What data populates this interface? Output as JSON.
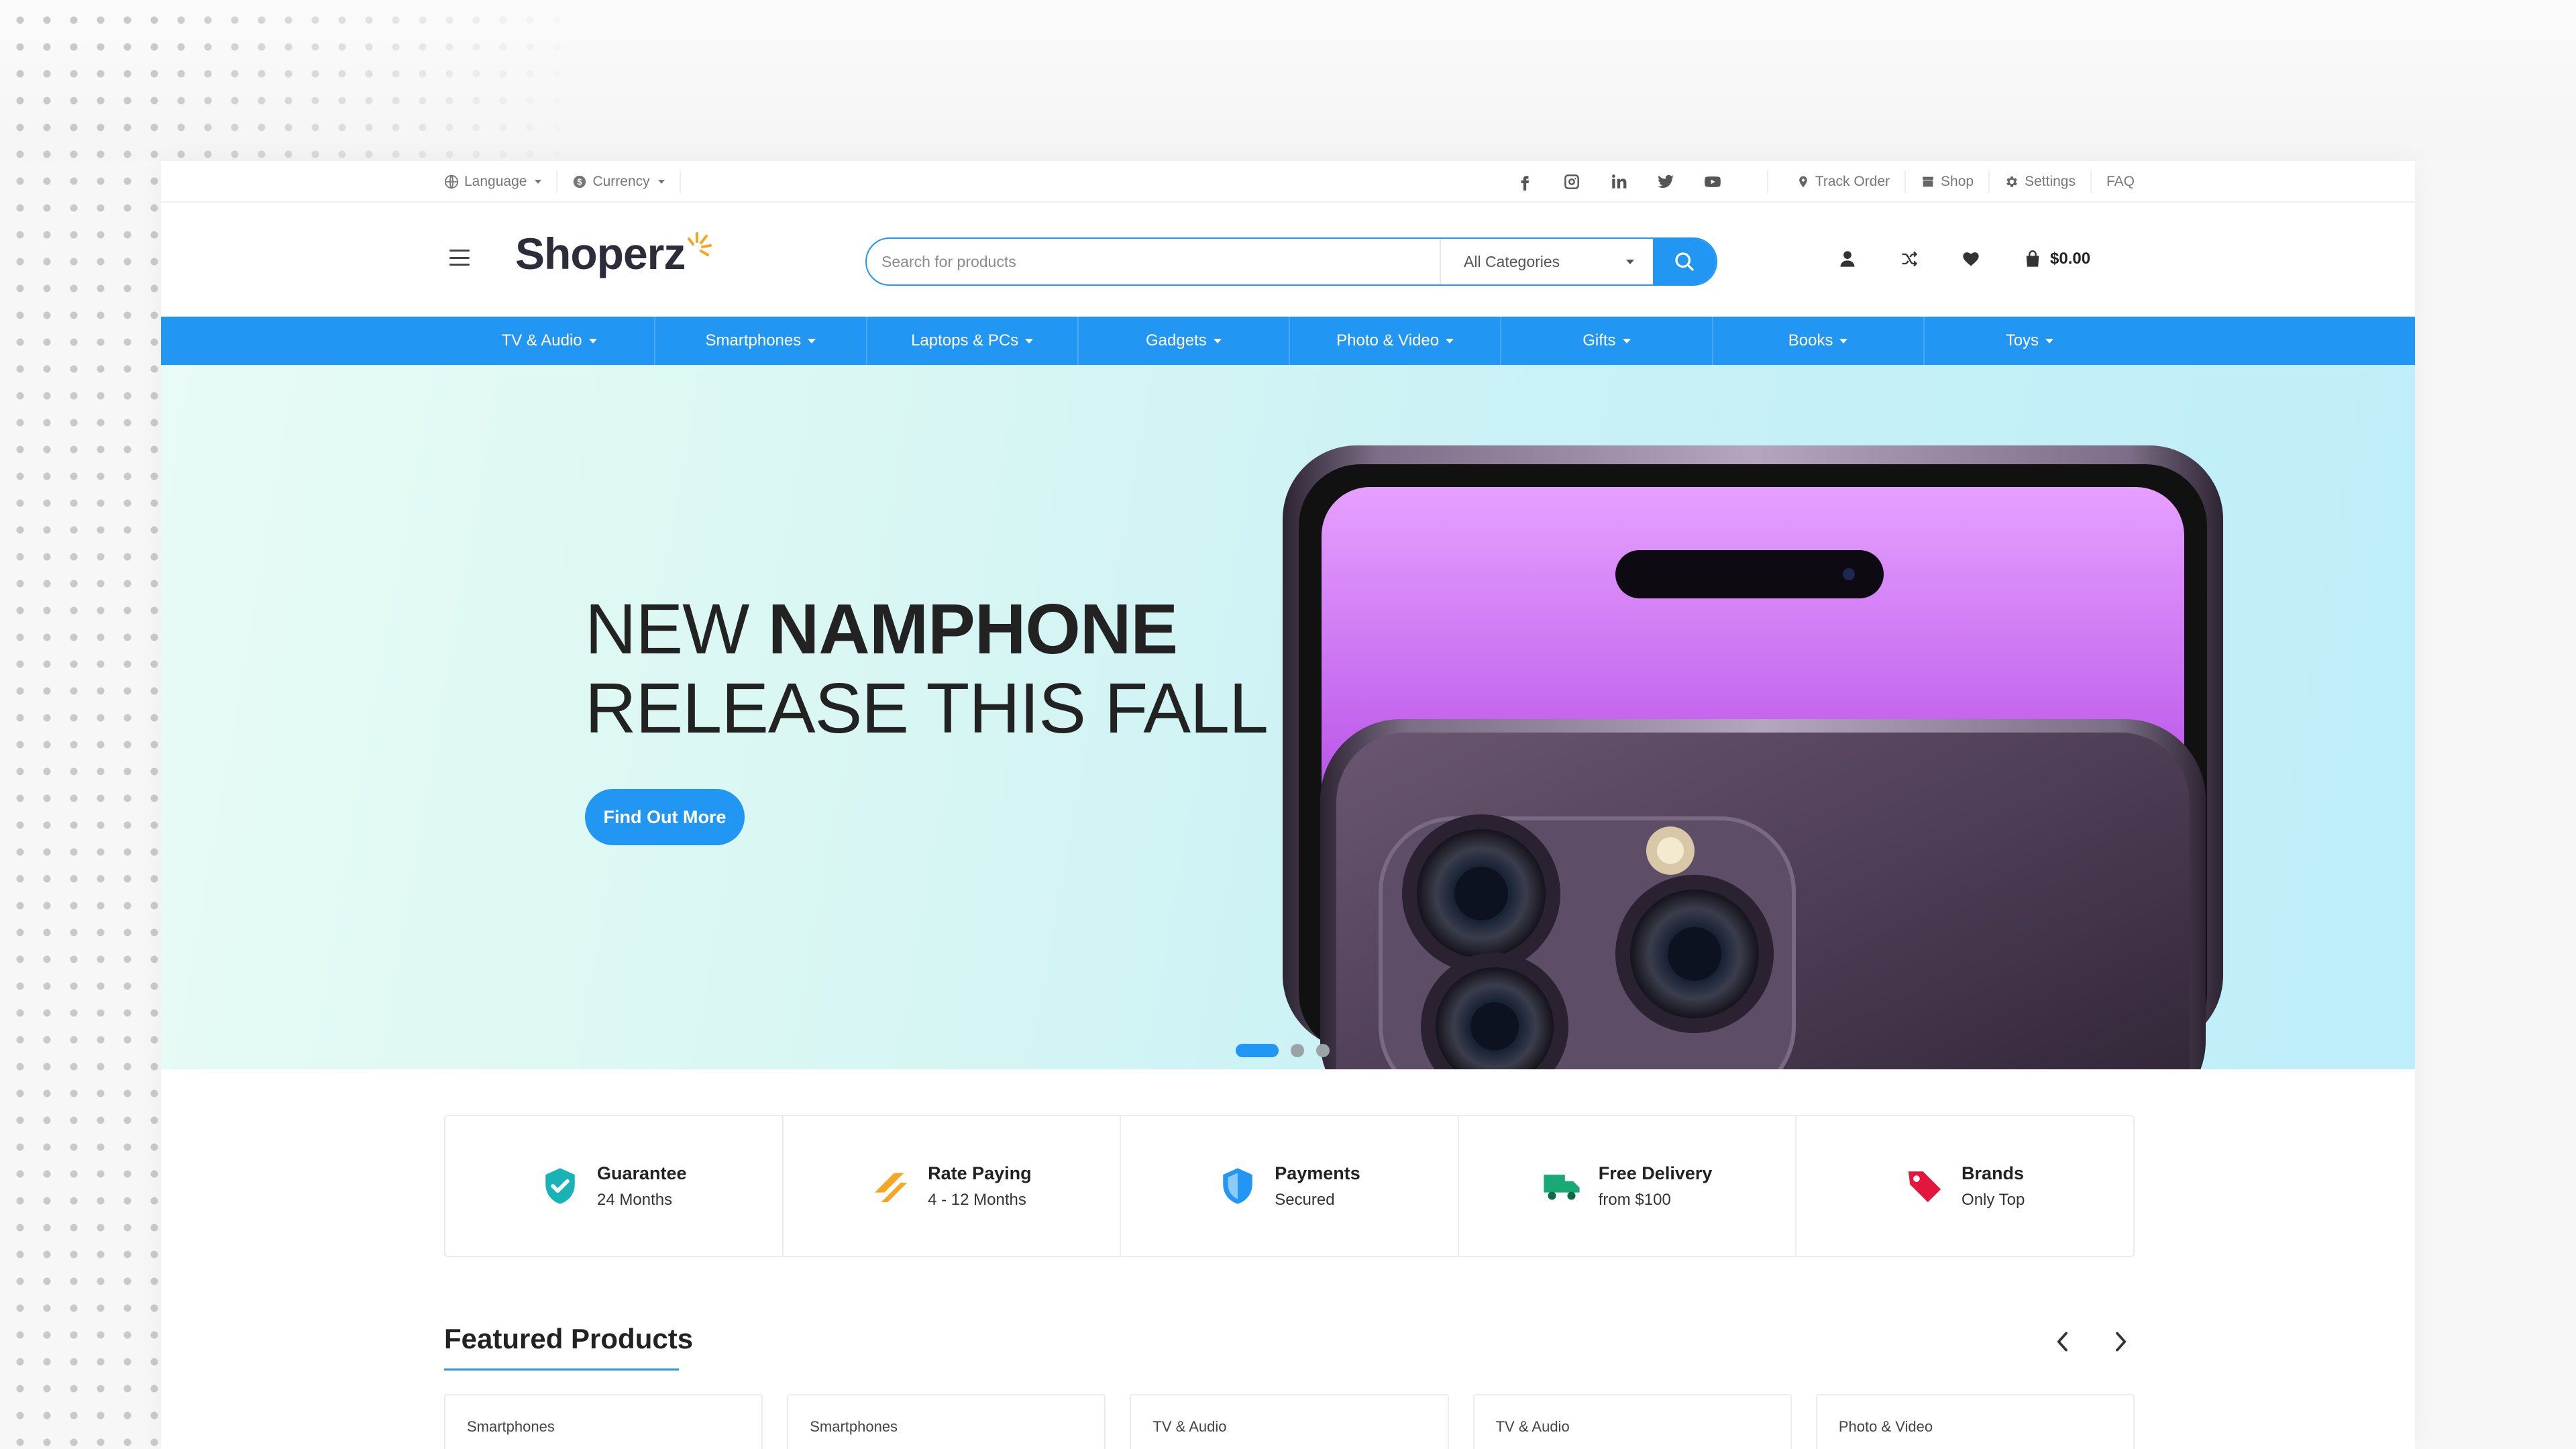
{
  "topbar": {
    "language": "Language",
    "currency": "Currency",
    "social": [
      "facebook-icon",
      "instagram-icon",
      "linkedin-icon",
      "twitter-icon",
      "youtube-icon"
    ],
    "links": {
      "track_order": "Track Order",
      "shop": "Shop",
      "settings": "Settings",
      "faq": "FAQ"
    }
  },
  "header": {
    "logo": "Shoperz",
    "search_placeholder": "Search for products",
    "category": "All Categories",
    "cart_total": "$0.00"
  },
  "nav": [
    {
      "label": "TV & Audio"
    },
    {
      "label": "Smartphones"
    },
    {
      "label": "Laptops & PCs"
    },
    {
      "label": "Gadgets"
    },
    {
      "label": "Photo & Video"
    },
    {
      "label": "Gifts"
    },
    {
      "label": "Books"
    },
    {
      "label": "Toys"
    }
  ],
  "hero": {
    "line1_light": "NEW ",
    "line1_bold": "NAMPHONE",
    "line2": "RELEASE THIS FALL",
    "button": "Find Out More",
    "slides_count": 3,
    "active_slide": 1
  },
  "features": [
    {
      "title": "Guarantee",
      "subtitle": "24 Months",
      "icon": "shield-check-icon",
      "color": "#17b3b6"
    },
    {
      "title": "Rate Paying",
      "subtitle": "4 - 12 Months",
      "icon": "stripes-icon",
      "color": "#f5a623"
    },
    {
      "title": "Payments",
      "subtitle": "Secured",
      "icon": "shield-icon",
      "color": "#2196f3"
    },
    {
      "title": "Free Delivery",
      "subtitle": "from $100",
      "icon": "truck-icon",
      "color": "#19a974"
    },
    {
      "title": "Brands",
      "subtitle": "Only Top",
      "icon": "tag-icon",
      "color": "#e3173e"
    }
  ],
  "featured": {
    "title": "Featured Products",
    "cards": [
      "Smartphones",
      "Smartphones",
      "TV & Audio",
      "TV & Audio",
      "Photo & Video"
    ]
  },
  "colors": {
    "accent": "#2196f3"
  }
}
